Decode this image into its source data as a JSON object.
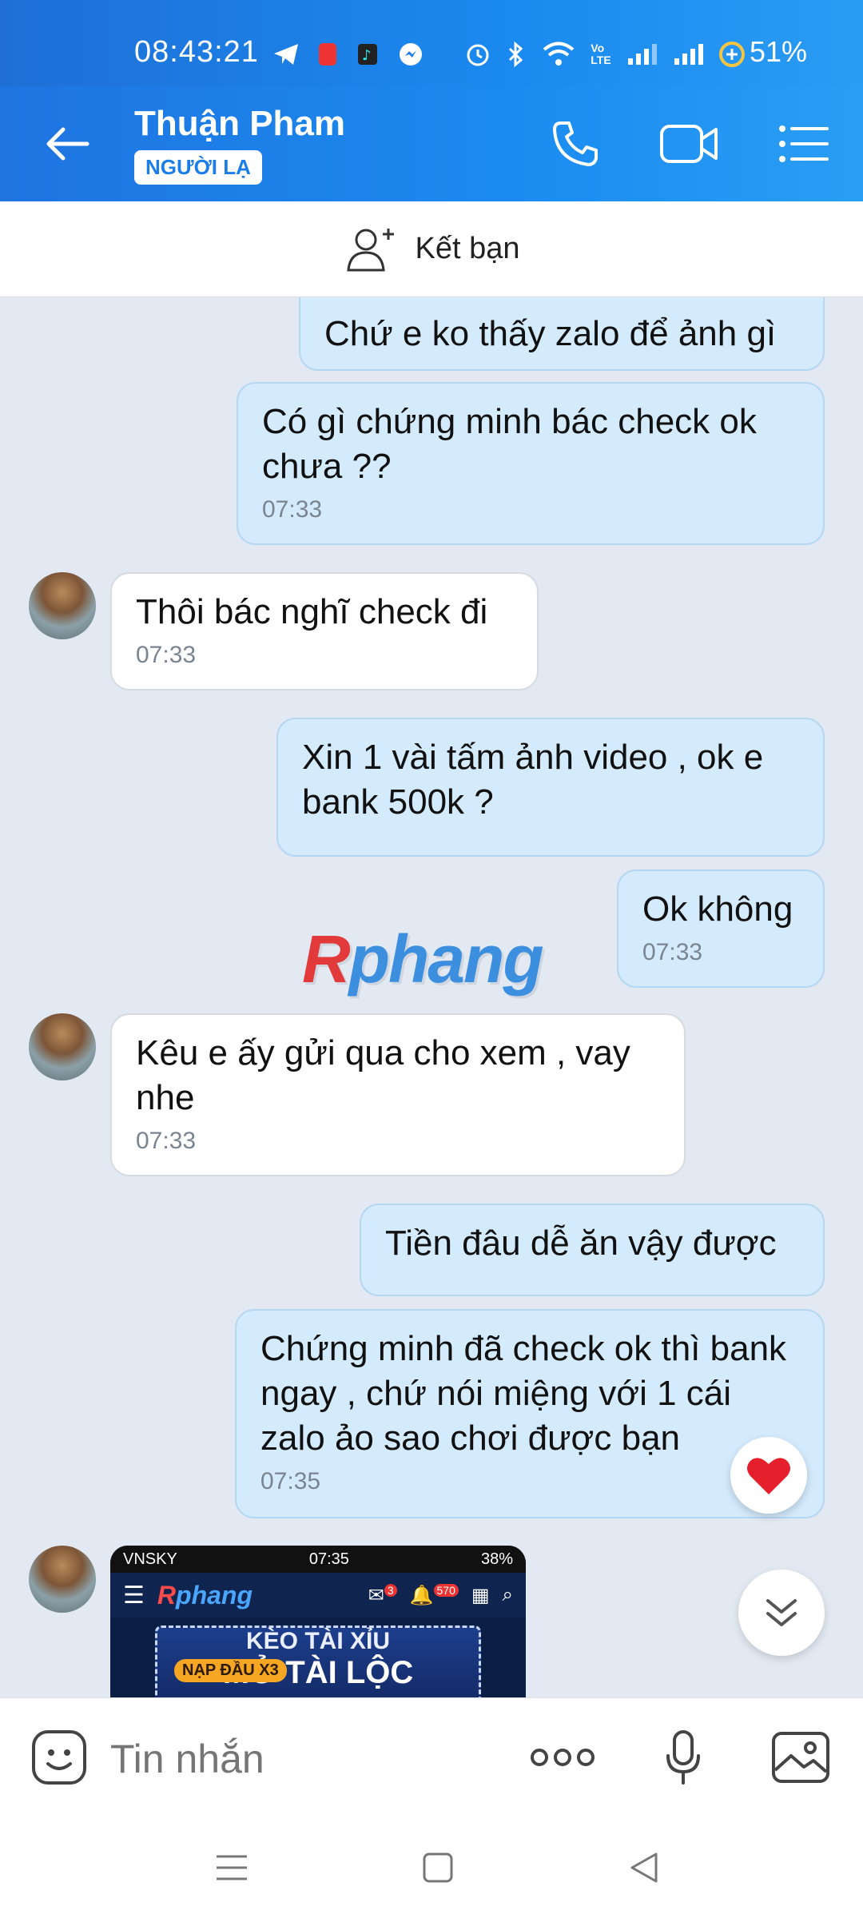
{
  "status_bar": {
    "time": "08:43:21",
    "battery": "51%",
    "icons": [
      "telegram-icon",
      "app-icon",
      "tiktok-icon",
      "messenger-icon",
      "alarm-icon",
      "bluetooth-icon",
      "wifi-icon",
      "volte-icon",
      "signal-icon",
      "signal-icon",
      "battery-saver-icon"
    ]
  },
  "header": {
    "contact_name": "Thuận Pham",
    "badge": "NGƯỜI LẠ",
    "icons": [
      "back-arrow-icon",
      "phone-icon",
      "video-call-icon",
      "menu-icon"
    ]
  },
  "friend_bar": {
    "label": "Kết bạn",
    "icon": "add-friend-icon"
  },
  "messages": [
    {
      "side": "out",
      "text": "Chứ e ko thấy zalo để ảnh gì",
      "time": ""
    },
    {
      "side": "out",
      "text": "Có gì chứng minh bác check ok chưa ??",
      "time": "07:33"
    },
    {
      "side": "in",
      "text": "Thôi bác nghĩ check đi",
      "time": "07:33"
    },
    {
      "side": "out",
      "text": "Xin 1 vài tấm ảnh video , ok e bank 500k ?",
      "time": ""
    },
    {
      "side": "out",
      "text": "Ok không",
      "time": "07:33"
    },
    {
      "side": "in",
      "text": "Kêu e ấy gửi qua cho xem , vay nhe",
      "time": "07:33"
    },
    {
      "side": "out",
      "text": "Tiền đâu dễ ăn vậy được",
      "time": ""
    },
    {
      "side": "out",
      "text": "Chứng minh đã check ok thì bank ngay , chứ nói miệng với 1 cái zalo ảo sao chơi được bạn",
      "time": "07:35"
    }
  ],
  "watermark": {
    "first": "R",
    "rest": "phang"
  },
  "image_message": {
    "carrier": "VNSKY",
    "time": "07:35",
    "battery": "38%",
    "logo_first": "R",
    "logo_rest": "phang",
    "badge_mail": "3",
    "badge_bell": "570",
    "banner_line1": "KÈO TÀI XỈU",
    "banner_line2": "MỞ TÀI LỘC",
    "tag": "NẠP ĐẦU X3"
  },
  "input": {
    "placeholder": "Tin nhắn",
    "icons": [
      "emoji-icon",
      "more-icon",
      "microphone-icon",
      "gallery-icon"
    ]
  },
  "nav": {
    "icons": [
      "recent-apps-icon",
      "home-icon",
      "back-icon"
    ]
  },
  "colors": {
    "primary": "#1a7de8",
    "out_bubble": "#d4ebfd",
    "in_bubble": "#ffffff",
    "chat_bg": "#e2e9f2"
  }
}
